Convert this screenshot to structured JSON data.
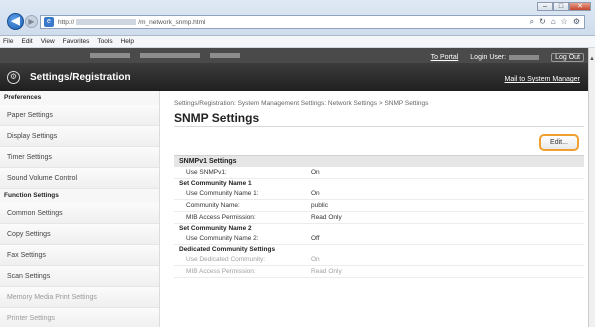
{
  "browser": {
    "url_prefix": "http://",
    "url_suffix": "/m_network_snmp.html",
    "minimize_label": "–",
    "maximize_label": "□",
    "close_label": "✕",
    "search_glyph": "⌕",
    "refresh_glyph": "↻",
    "home_glyph": "⌂",
    "favorites_glyph": "☆",
    "tools_glyph": "⚙",
    "back_glyph": "◀",
    "forward_glyph": "▶",
    "favicon_glyph": "e"
  },
  "menubar": {
    "items": [
      "File",
      "Edit",
      "View",
      "Favorites",
      "Tools",
      "Help"
    ]
  },
  "header": {
    "app_title": "Settings/Registration",
    "app_icon_glyph": "⚙",
    "to_portal": "To Portal",
    "login_user_label": "Login User:",
    "log_out": "Log Out",
    "mail_link": "Mail to System Manager"
  },
  "sidebar": {
    "sections": [
      {
        "title": "Preferences",
        "items": [
          "Paper Settings",
          "Display Settings",
          "Timer Settings",
          "Sound Volume Control"
        ]
      },
      {
        "title": "Function Settings",
        "items": [
          "Common Settings",
          "Copy Settings",
          "Fax Settings",
          "Scan Settings",
          "Memory Media Print Settings",
          "Printer Settings"
        ]
      }
    ]
  },
  "main": {
    "breadcrumb": "Settings/Registration: System Management Settings: Network Settings > SNMP Settings",
    "title": "SNMP Settings",
    "edit_label": "Edit..."
  },
  "snmp": {
    "section_title": "SNMPv1 Settings",
    "use_snmpv1": {
      "label": "Use SNMPv1:",
      "value": "On"
    },
    "community1_title": "Set Community Name 1",
    "community1_rows": [
      {
        "label": "Use Community Name 1:",
        "value": "On"
      },
      {
        "label": "Community Name:",
        "value": "public"
      },
      {
        "label": "MIB Access Permission:",
        "value": "Read Only"
      }
    ],
    "community2_title": "Set Community Name 2",
    "community2_rows": [
      {
        "label": "Use Community Name 2:",
        "value": "Off"
      }
    ],
    "dedicated_title": "Dedicated Community Settings",
    "dedicated_rows": [
      {
        "label": "Use Dedicated Community:",
        "value": "On"
      },
      {
        "label": "MIB Access Permission:",
        "value": "Read Only"
      }
    ]
  },
  "colors": {
    "header_bg": "#2d2d2d",
    "edit_highlight": "#f0a030",
    "section_bg": "#e6e6e6"
  }
}
